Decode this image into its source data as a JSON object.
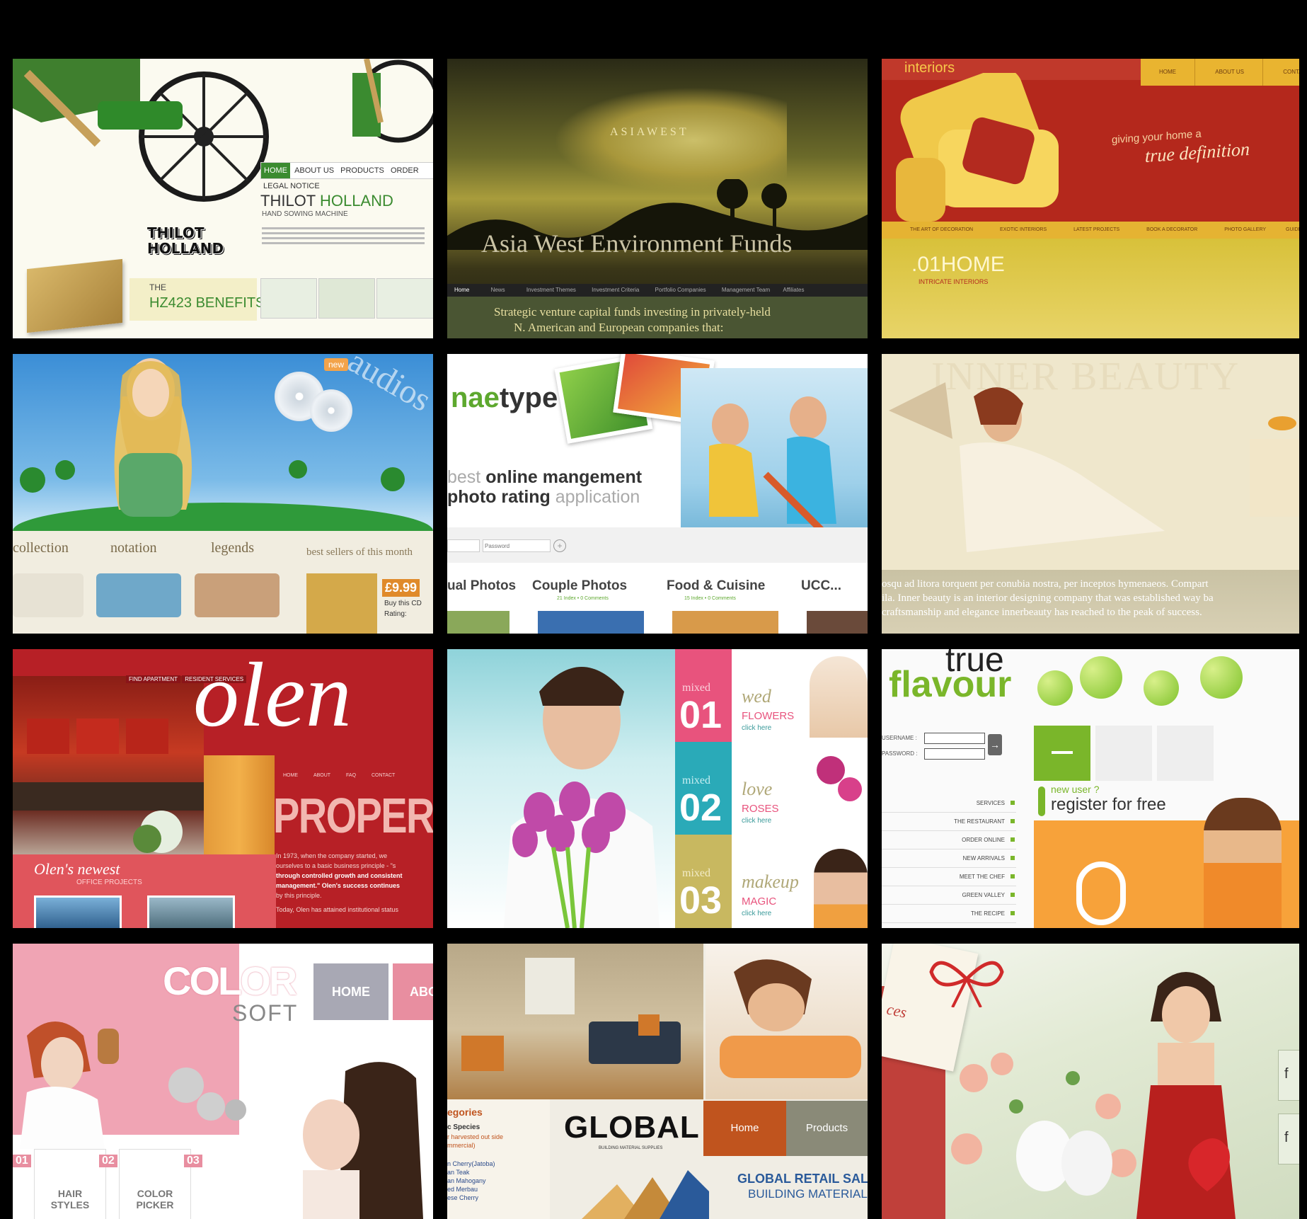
{
  "tiles": {
    "thilot": {
      "nav": [
        "HOME",
        "ABOUT US",
        "PRODUCTS",
        "ORDER",
        "LEGAL NOTICE"
      ],
      "brand_line1": "THILOT",
      "brand_line2": "HOLLAND",
      "subtitle": "HAND SOWING MACHINE",
      "logo_line1": "THILOT",
      "logo_line2": "HOLLAND",
      "benefits_prefix": "THE",
      "benefits_title": "HZ423 BENEFITS"
    },
    "asiawest": {
      "logo": "ASIAWEST",
      "title": "Asia West Environment Funds",
      "nav": [
        "Home",
        "News",
        "Investment Themes",
        "Investment Criteria",
        "Portfolio Companies",
        "Management Team",
        "Affiliates"
      ],
      "tagline_1": "Strategic venture capital funds investing in privately-held",
      "tagline_2": "N. American and European companies that:"
    },
    "interiors": {
      "logo": "interiors",
      "nav": [
        "HOME",
        "ABOUT US",
        "CONTACT"
      ],
      "tagline_1": "giving your home a",
      "tagline_2": "true definition",
      "menu": [
        "THE ART OF DECORATION",
        "EXOTIC INTERIORS",
        "LATEST PROJECTS",
        "BOOK A DECORATOR",
        "PHOTO GALLERY",
        "GUIDE"
      ],
      "section": ".01HOME",
      "section_sub": "INTRICATE INTERIORS"
    },
    "audios": {
      "badge": "new",
      "title": "audios",
      "tabs": [
        "collection",
        "notation",
        "legends"
      ],
      "bestsellers": "best sellers of this month",
      "price": "£9.99",
      "buy": "Buy this CD",
      "rating": "Rating:"
    },
    "naetype": {
      "logo_a": "nae",
      "logo_b": "type",
      "headline_1a": "best ",
      "headline_1b": "online mangement",
      "headline_2a": "photo rating ",
      "headline_2b": "application",
      "password_placeholder": "Password",
      "categories": [
        "ual Photos",
        "Couple Photos",
        "Food & Cuisine",
        "UCC..."
      ],
      "counts": [
        "21 Index • 0 Comments",
        "15 Index • 0 Comments"
      ]
    },
    "innerbeauty": {
      "title": "INNER BEAUTY",
      "text_1": "osqu ad litora torquent per conubia nostra, per inceptos hymenaeos. Compart",
      "text_2": "ila. Inner beauty is an interior designing company that was established way ba",
      "text_3": "craftsmanship and elegance innerbeauty has reached to the peak of success."
    },
    "olen": {
      "top_links": [
        "FIND APARTMENT",
        "RESIDENT SERVICES"
      ],
      "logo": "olen",
      "nav": [
        "HOME",
        "ABOUT",
        "FAQ",
        "CONTACT"
      ],
      "headline": "PROPERTI",
      "projects_1": "Olen's newest",
      "projects_2": "OFFICE PROJECTS",
      "body_1": "In 1973, when the company started, we",
      "body_2": "ourselves to a basic business principle - \"s",
      "body_3": "through controlled growth and consistent",
      "body_4": "management.\" Olen's success continues",
      "body_5": "by this principle.",
      "body_6": "Today, Olen has attained institutional status"
    },
    "flowers": {
      "items": [
        {
          "mixed": "mixed",
          "num": "01",
          "script": "wed",
          "caps": "FLOWERS",
          "click": "click here"
        },
        {
          "mixed": "mixed",
          "num": "02",
          "script": "love",
          "caps": "ROSES",
          "click": "click here"
        },
        {
          "mixed": "mixed",
          "num": "03",
          "script": "makeup",
          "caps": "MAGIC",
          "click": "click here"
        }
      ]
    },
    "trueflavour": {
      "logo_top": "true",
      "logo_bottom": "flavour",
      "username_label": "USERNAME :",
      "password_label": "PASSWORD :",
      "menu": [
        "SERVICES",
        "THE RESTAURANT",
        "ORDER ONLINE",
        "NEW ARRIVALS",
        "MEET THE CHEF",
        "GREEN VALLEY",
        "THE RECIPE"
      ],
      "new_user": "new user ?",
      "register": "register for free"
    },
    "colorsoft": {
      "logo_top": "COLOR",
      "logo_bottom": "SOFT",
      "nav": [
        "HOME",
        "ABOUT"
      ],
      "numbers": [
        "01",
        "02",
        "03"
      ],
      "cards": [
        "HAIR STYLES",
        "COLOR PICKER"
      ]
    },
    "global": {
      "sidebar_title": "egories",
      "sidebar_sub": "c Species",
      "sidebar_items": [
        "r harvested out side",
        "mmercial)",
        "n Cherry(Jatoba)",
        "an Teak",
        "an Mahogany",
        "ed Merbau",
        "ese Cherry"
      ],
      "logo": "GLOBAL",
      "logo_sub": "BUILDING MATERIAL SUPPLIES",
      "nav": [
        "Home",
        "Products"
      ],
      "sales_1": "GLOBAL RETAIL SALES",
      "sales_2": "BUILDING MATERIALS"
    },
    "gift": {
      "tag_text": "ces",
      "side_letters": [
        "f",
        "f"
      ]
    }
  }
}
